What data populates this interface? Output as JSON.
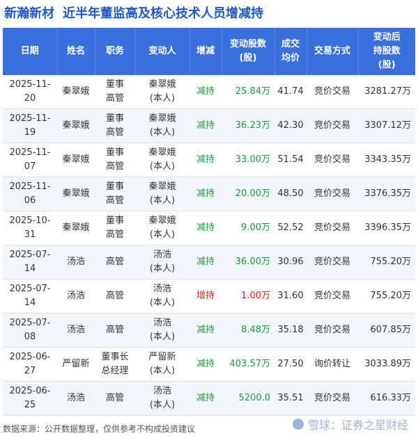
{
  "header": {
    "brand": "新瀚新材",
    "title": "近半年董监高及核心技术人员增减持"
  },
  "columns": [
    "日期",
    "姓名",
    "职务",
    "变动人",
    "增减",
    "变动股数(股)",
    "成交均价",
    "交易方式",
    "变动后持股数(股)"
  ],
  "header_lines": [
    [
      "日期"
    ],
    [
      "姓名"
    ],
    [
      "职务"
    ],
    [
      "变动人"
    ],
    [
      "增减"
    ],
    [
      "变动股数",
      "(股)"
    ],
    [
      "成交",
      "均价"
    ],
    [
      "交易方式"
    ],
    [
      "变动后",
      "持股数",
      "(股)"
    ]
  ],
  "rows": [
    {
      "date": "2025-11-20",
      "name": "秦翠娥",
      "role": [
        "董事",
        "高管"
      ],
      "person": [
        "秦翠娥",
        "(本人)"
      ],
      "dir": "减持",
      "shares": "25.84万",
      "price": "41.74",
      "method": "竞价交易",
      "after": "3281.27万"
    },
    {
      "date": "2025-11-19",
      "name": "秦翠娥",
      "role": [
        "董事",
        "高管"
      ],
      "person": [
        "秦翠娥",
        "(本人)"
      ],
      "dir": "减持",
      "shares": "36.23万",
      "price": "42.30",
      "method": "竞价交易",
      "after": "3307.12万"
    },
    {
      "date": "2025-11-07",
      "name": "秦翠娥",
      "role": [
        "董事",
        "高管"
      ],
      "person": [
        "秦翠娥",
        "(本人)"
      ],
      "dir": "减持",
      "shares": "33.00万",
      "price": "51.54",
      "method": "竞价交易",
      "after": "3343.35万"
    },
    {
      "date": "2025-11-06",
      "name": "秦翠娥",
      "role": [
        "董事",
        "高管"
      ],
      "person": [
        "秦翠娥",
        "(本人)"
      ],
      "dir": "减持",
      "shares": "20.00万",
      "price": "48.50",
      "method": "竞价交易",
      "after": "3376.35万"
    },
    {
      "date": "2025-10-31",
      "name": "秦翠娥",
      "role": [
        "董事",
        "高管"
      ],
      "person": [
        "秦翠娥",
        "(本人)"
      ],
      "dir": "减持",
      "shares": "9.00万",
      "price": "52.52",
      "method": "竞价交易",
      "after": "3396.35万"
    },
    {
      "date": "2025-07-14",
      "name": "汤浩",
      "role": [
        "高管"
      ],
      "person": [
        "汤浩",
        "(本人)"
      ],
      "dir": "减持",
      "shares": "36.00万",
      "price": "30.96",
      "method": "竞价交易",
      "after": "755.20万"
    },
    {
      "date": "2025-07-14",
      "name": "汤浩",
      "role": [
        "高管"
      ],
      "person": [
        "汤浩",
        "(本人)"
      ],
      "dir": "增持",
      "shares": "1.00万",
      "price": "31.60",
      "method": "竞价交易",
      "after": "755.20万"
    },
    {
      "date": "2025-07-08",
      "name": "汤浩",
      "role": [
        "高管"
      ],
      "person": [
        "汤浩",
        "(本人)"
      ],
      "dir": "减持",
      "shares": "8.48万",
      "price": "35.18",
      "method": "竞价交易",
      "after": "607.85万"
    },
    {
      "date": "2025-06-27",
      "name": "严留新",
      "role": [
        "董事长",
        "总经理"
      ],
      "person": [
        "严留新",
        "(本人)"
      ],
      "dir": "减持",
      "shares": "403.57万",
      "price": "27.50",
      "method": "询价转让",
      "after": "3033.89万"
    },
    {
      "date": "2025-06-25",
      "name": "汤浩",
      "role": [
        "高管"
      ],
      "person": [
        "汤浩",
        "(本人)"
      ],
      "dir": "减持",
      "shares": "5200.0",
      "price": "35.51",
      "method": "竞价交易",
      "after": "616.33万"
    }
  ],
  "colors": {
    "header_bg": "#3a6fdc",
    "title_text": "#1e57c9",
    "decrease": "#1a9b3c",
    "increase": "#e02020"
  },
  "footer": {
    "source": "数据来源：公开数据整理，仅供参考不构成投资建议"
  },
  "watermark": {
    "text": "雪球：证券之星财经",
    "icon": "snowball-icon"
  }
}
